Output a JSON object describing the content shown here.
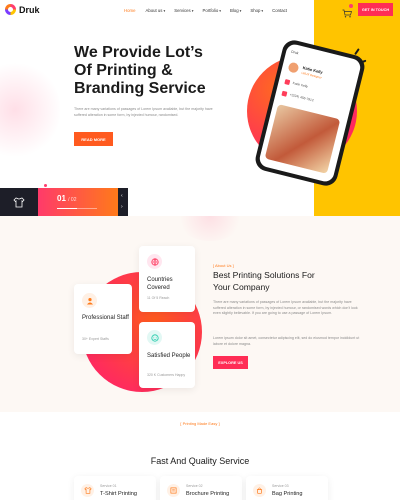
{
  "brand": {
    "name": "Druk"
  },
  "nav": [
    {
      "label": "Home",
      "active": true,
      "dropdown": false
    },
    {
      "label": "About us",
      "active": false,
      "dropdown": true
    },
    {
      "label": "Services",
      "active": false,
      "dropdown": true
    },
    {
      "label": "Portfolio",
      "active": false,
      "dropdown": true
    },
    {
      "label": "Blog",
      "active": false,
      "dropdown": true
    },
    {
      "label": "Shop",
      "active": false,
      "dropdown": true
    },
    {
      "label": "Contact",
      "active": false,
      "dropdown": false
    }
  ],
  "header": {
    "cta_label": "GET IN TOUCH",
    "cart_icon": "cart-icon"
  },
  "hero": {
    "title_line1": "We Provide Lot’s",
    "title_line2": "Of Printing &",
    "title_line3": "Branding Service",
    "text": "There are many variations of passages of Lorem Ipsum available, but the majority have suffered alteration in some form, by injected humour, randomised.",
    "button_label": "READ MORE",
    "slider": {
      "current": "01",
      "total": "/ 02",
      "progress": 0.5
    },
    "phone": {
      "app_name": "Druk",
      "person_name": "Katie Kelly",
      "person_role": "UI/UX Designer",
      "row1": "Katie Kelly",
      "row2": "+(324) 456-7912"
    }
  },
  "about": {
    "cards": [
      {
        "title": "Professional Staff",
        "sub": "30+ Expert Staffs",
        "icon": "staff-icon"
      },
      {
        "title": "Countries Covered",
        "sub": "11 Of 5 Reach",
        "icon": "globe-icon"
      },
      {
        "title": "Satisfied People",
        "sub": "320 K Customers Happy",
        "icon": "smile-icon"
      }
    ],
    "tag": "[ About Us ]",
    "title_line1": "Best Printing Solutions For",
    "title_line2": "Your Company",
    "para1": "There are many variations of passages of Lorem Ipsum available, but the majority have suffered alteration in some form, by injected humour, or randomised words which don't look even slightly believable. If you are going to use a passage of Lorem Ipsum.",
    "para2": "Lorem ipsum dolor sit amet, consectetur adipiscing elit, sed do eiusmod tempor incididunt ut labore et dolore magna.",
    "button_label": "EXPLORE US"
  },
  "services": {
    "tag": "[ Printing Made Easy ]",
    "title": "Fast And Quality Service",
    "items": [
      {
        "num": "Service 01",
        "name": "T-Shirt Printing",
        "icon": "tshirt-icon"
      },
      {
        "num": "Service 02",
        "name": "Brochure Printing",
        "icon": "brochure-icon"
      },
      {
        "num": "Service 03",
        "name": "Bag Printing",
        "icon": "bag-icon"
      }
    ]
  },
  "colors": {
    "accent": "#ff2d55",
    "orange": "#ff7a1a",
    "yellow": "#ffc400",
    "dark": "#1d1e28"
  }
}
